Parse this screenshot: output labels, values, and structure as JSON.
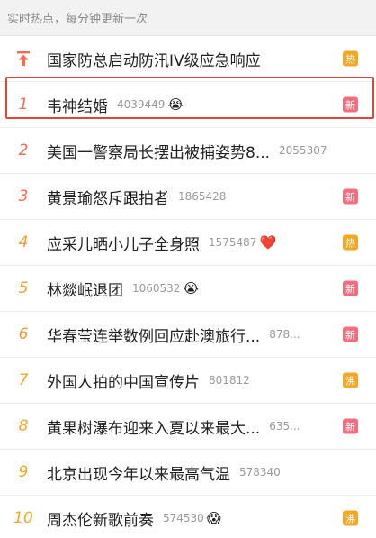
{
  "header": {
    "text": "实时热点，每分钟更新一次"
  },
  "pinned": {
    "title": "国家防总启动防汛IV级应急响应",
    "badge": "热"
  },
  "items": [
    {
      "rank": "1",
      "title": "韦神结婚",
      "count": "4039449",
      "emoji": "😭",
      "badge": "新"
    },
    {
      "rank": "2",
      "title": "美国一警察局长摆出被捕姿势8...",
      "count": "2055307",
      "emoji": "",
      "badge": ""
    },
    {
      "rank": "3",
      "title": "黄景瑜怒斥跟拍者",
      "count": "1865428",
      "emoji": "",
      "badge": "新"
    },
    {
      "rank": "4",
      "title": "应采儿晒小儿子全身照",
      "count": "1575487",
      "emoji": "❤️",
      "badge": "热"
    },
    {
      "rank": "5",
      "title": "林燚岷退团",
      "count": "1060532",
      "emoji": "😭",
      "badge": "新"
    },
    {
      "rank": "6",
      "title": "华春莹连举数例回应赴澳旅行...",
      "count": "878...",
      "emoji": "",
      "badge": "新"
    },
    {
      "rank": "7",
      "title": "外国人拍的中国宣传片",
      "count": "801812",
      "emoji": "",
      "badge": "沸"
    },
    {
      "rank": "8",
      "title": "黄果树瀑布迎来入夏以来最大...",
      "count": "635...",
      "emoji": "",
      "badge": "新"
    },
    {
      "rank": "9",
      "title": "北京出现今年以来最高气温",
      "count": "578340",
      "emoji": "",
      "badge": ""
    },
    {
      "rank": "10",
      "title": "周杰伦新歌前奏",
      "count": "574530",
      "emoji": "😱",
      "badge": "沸"
    }
  ],
  "colors": {
    "rank_top": "#f26d52",
    "rank_mid": "#f59a35",
    "rank_low": "#f5a623",
    "badge_hot": "#f5a623",
    "badge_new": "#f26d7d",
    "highlight": "#e2463a"
  }
}
